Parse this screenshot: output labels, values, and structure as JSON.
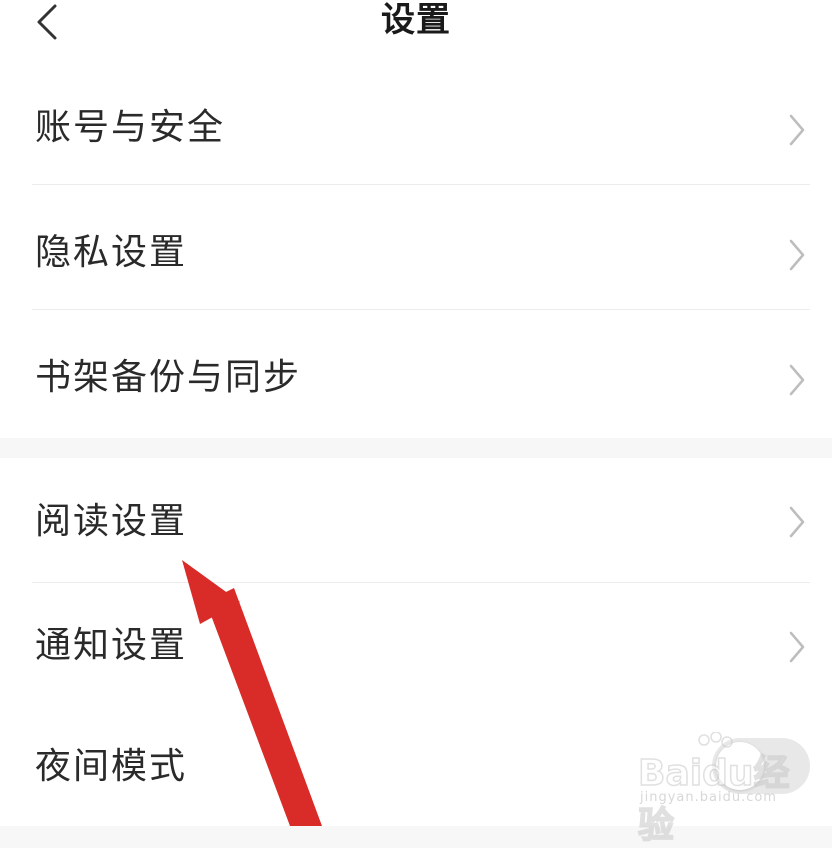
{
  "header": {
    "title": "设置",
    "back_icon": "chevron-left-icon"
  },
  "groups": [
    {
      "items": [
        {
          "label": "账号与安全",
          "accessory": "chevron-right-icon"
        },
        {
          "label": "隐私设置",
          "accessory": "chevron-right-icon"
        },
        {
          "label": "书架备份与同步",
          "accessory": "chevron-right-icon"
        }
      ]
    },
    {
      "items": [
        {
          "label": "阅读设置",
          "accessory": "chevron-right-icon"
        },
        {
          "label": "通知设置",
          "accessory": "chevron-right-icon"
        },
        {
          "label": "夜间模式",
          "accessory": "toggle",
          "toggle_on": false
        }
      ]
    }
  ],
  "annotation": {
    "arrow_color": "#d92b27",
    "points_to": "阅读设置"
  },
  "watermark": {
    "brand": "Baidu经验",
    "url": "jingyan.baidu.com"
  },
  "colors": {
    "background": "#f7f7f7",
    "row_background": "#ffffff",
    "divider": "#ececec",
    "text": "#2a2a2a",
    "chevron": "#bdbdbd"
  }
}
